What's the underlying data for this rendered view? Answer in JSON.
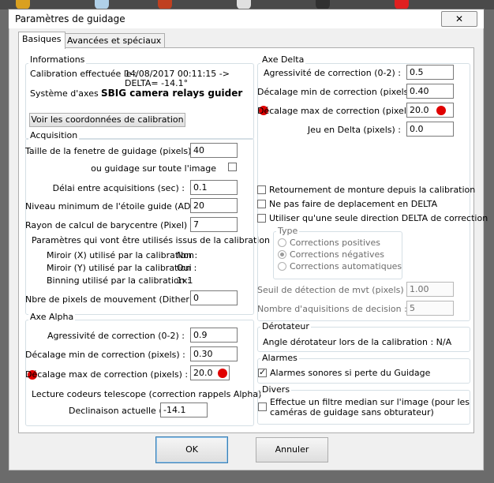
{
  "window": {
    "title": "Paramètres de guidage",
    "close_glyph": "✕"
  },
  "tabs": [
    {
      "label": "Basiques"
    },
    {
      "label": "Avancées et spéciaux"
    }
  ],
  "informations": {
    "group": "Informations",
    "calibration_label": "Calibration effectuée le :",
    "calibration_value": "14/08/2017 00:11:15 ->",
    "delta_value": "DELTA= -14.1°",
    "axes_label": "Système d'axes :",
    "axes_value": "SBIG camera relays guider",
    "coords_button": "Voir les coordonnées de calibration"
  },
  "acquisition": {
    "group": "Acquisition",
    "window_size_label": "Taille de la fenetre de guidage (pixels) :",
    "window_size_value": "40",
    "full_image_label": "ou guidage sur toute l'image",
    "delay_label": "Délai entre acquisitions (sec) :",
    "delay_value": "0.1",
    "min_star_label": "Niveau minimum de l'étoile guide (ADU) :",
    "min_star_value": "20",
    "radius_label": "Rayon de calcul de barycentre (Pixel) :",
    "radius_value": "7",
    "params_heading": "Paramètres qui vont être utilisés issus de la calibration",
    "mirror_x_label": "Miroir (X) utilisé par la calibration :",
    "mirror_x_value": "Non",
    "mirror_y_label": "Miroir (Y) utilisé par la calibration :",
    "mirror_y_value": "Oui",
    "binning_label": "Binning utilisé par la calibration :",
    "binning_value": "1x1",
    "dither_label": "Nbre de pixels de mouvement (Dither) :",
    "dither_value": "0"
  },
  "axe_alpha": {
    "group": "Axe Alpha",
    "aggr_label": "Agressivité de correction (0-2) :",
    "aggr_value": "0.9",
    "min_label": "Décalage min de correction (pixels) :",
    "min_value": "0.30",
    "max_label": "Décalage max de correction (pixels) :",
    "max_value": "20.0",
    "encoders_label": "Lecture codeurs telescope  (correction rappels Alpha)",
    "decl_label": "Declinaison actuelle (°) :",
    "decl_value": "-14.1"
  },
  "axe_delta": {
    "group": "Axe Delta",
    "aggr_label": "Agressivité de correction  (0-2) :",
    "aggr_value": "0.5",
    "min_label": "Décalage min de correction (pixels) :",
    "min_value": "0.40",
    "max_label": "Décalage max de correction (pixels) :",
    "max_value": "20.0",
    "backlash_label": "Jeu en Delta (pixels) :",
    "backlash_value": "0.0",
    "flip_label": "Retournement de monture depuis la calibration",
    "no_move_label": "Ne pas faire de deplacement en DELTA",
    "one_dir_label": "Utiliser qu'une seule direction DELTA de correction",
    "type_group": "Type",
    "type_options": [
      "Corrections positives",
      "Corrections négatives",
      "Corrections automatiques"
    ],
    "threshold_label": "Seuil de détection de mvt (pixels) :",
    "threshold_value": "1.00",
    "decision_label": "Nombre d'aquisitions de decision :",
    "decision_value": "5"
  },
  "derotateur": {
    "group": "Dérotateur",
    "angle_label": "Angle dérotateur lors de la calibration : N/A"
  },
  "alarmes": {
    "group": "Alarmes",
    "sound_label": "Alarmes sonores si perte du Guidage"
  },
  "divers": {
    "group": "Divers",
    "median_label_1": "Effectue un filtre median sur l'image (pour les",
    "median_label_2": "caméras de guidage sans obturateur)"
  },
  "buttons": {
    "ok": "OK",
    "cancel": "Annuler"
  },
  "colors": {
    "marker": "#e00000",
    "default_button_border": "#3c7fb1"
  }
}
